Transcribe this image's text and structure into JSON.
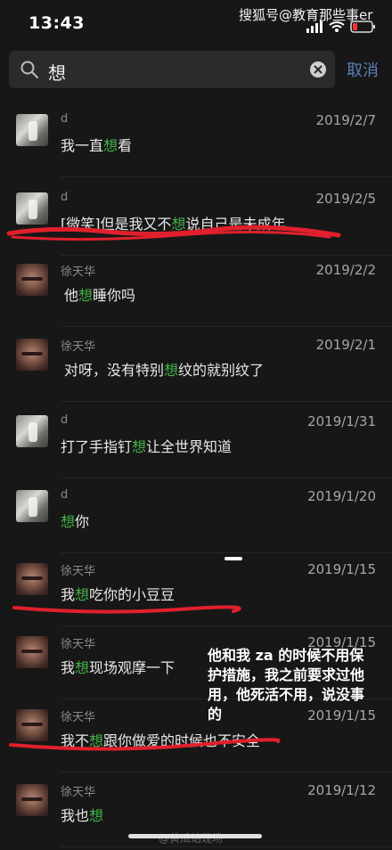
{
  "status": {
    "time": "13:43",
    "watermark": "搜狐号@教育那些事er"
  },
  "search": {
    "query": "想",
    "cancel_label": "取消"
  },
  "results": [
    {
      "sender": "d",
      "date": "2019/2/7",
      "avatar": "d",
      "pre": "我一直",
      "hl": "想",
      "post": "看",
      "underline": false
    },
    {
      "sender": "d",
      "date": "2019/2/5",
      "avatar": "d",
      "pre": "[微笑]但是我又不",
      "hl": "想",
      "post": "说自己是未成年",
      "underline": true
    },
    {
      "sender": "徐天华",
      "date": "2019/2/2",
      "avatar": "x",
      "pre": "他",
      "hl": "想",
      "post": "睡你吗",
      "underline": false
    },
    {
      "sender": "徐天华",
      "date": "2019/2/1",
      "avatar": "x",
      "pre": "对呀，没有特别",
      "hl": "想",
      "post": "纹的就别纹了",
      "underline": false
    },
    {
      "sender": "d",
      "date": "2019/1/31",
      "avatar": "d",
      "pre": "打了手指钉",
      "hl": "想",
      "post": "让全世界知道",
      "underline": false
    },
    {
      "sender": "d",
      "date": "2019/1/20",
      "avatar": "d",
      "pre": "",
      "hl": "想",
      "post": "你",
      "underline": false
    },
    {
      "sender": "徐天华",
      "date": "2019/1/15",
      "avatar": "x",
      "pre": "我",
      "hl": "想",
      "post": "吃你的小豆豆",
      "underline": true
    },
    {
      "sender": "徐天华",
      "date": "2019/1/15",
      "avatar": "x",
      "pre": "我",
      "hl": "想",
      "post": "现场观摩一下",
      "underline": false
    },
    {
      "sender": "徐天华",
      "date": "2019/1/15",
      "avatar": "x",
      "pre": "我不",
      "hl": "想",
      "post": "跟你做爱的时候也不安全",
      "underline": true
    },
    {
      "sender": "徐天华",
      "date": "2019/1/12",
      "avatar": "x",
      "pre": "我也",
      "hl": "想",
      "post": "",
      "underline": false
    }
  ],
  "annotation": "他和我 za 的时候不用保护措施，我之前要求过他用，他死活不用，说没事的",
  "bottom_watermark": "@黄瓜站现场",
  "colors": {
    "highlight": "#43b049",
    "cancel": "#5b7fb5",
    "underline": "#e0202c"
  }
}
